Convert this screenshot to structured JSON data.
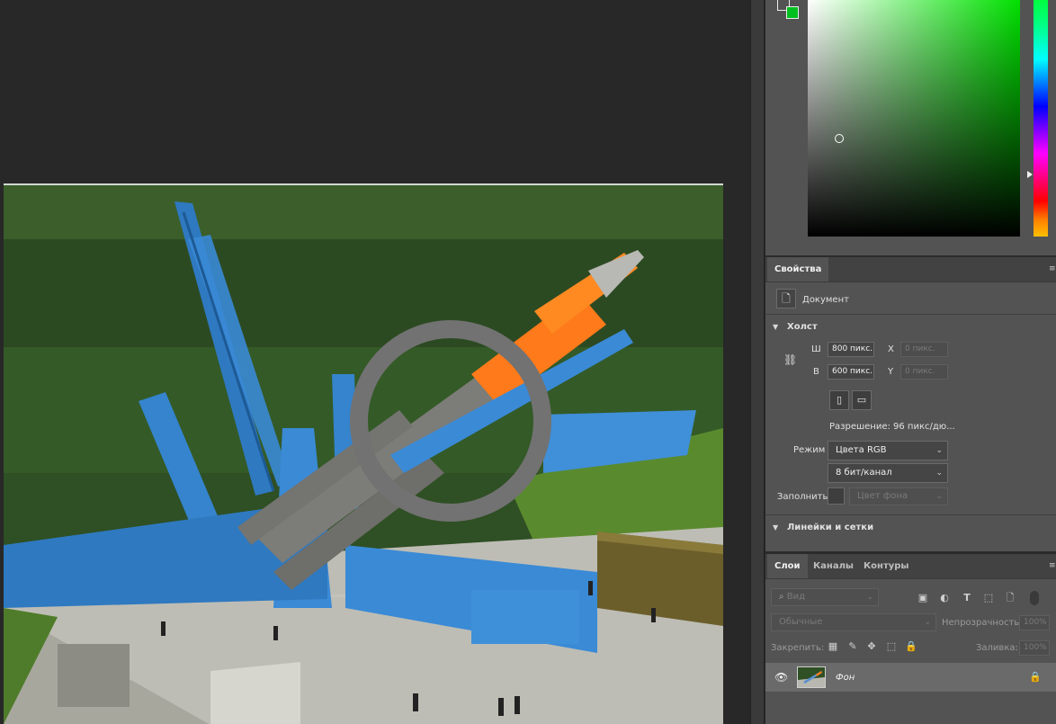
{
  "colors": {
    "foreground": "#e0e0e0",
    "background": "#00c020",
    "picker_hue": "#00e000"
  },
  "properties": {
    "tab_label": "Свойства",
    "doc_label": "Документ",
    "canvas_section": "Холст",
    "width_label": "Ш",
    "width_value": "800 пикс.",
    "height_label": "В",
    "height_value": "600 пикс.",
    "x_label": "X",
    "x_placeholder": "0 пикс.",
    "y_label": "Y",
    "y_placeholder": "0 пикс.",
    "resolution": "Разрешение: 96 пикс/дю...",
    "mode_label": "Режим",
    "mode_value": "Цвета RGB",
    "bit_depth": "8 бит/канал",
    "fill_label": "Заполнить",
    "fill_value": "Цвет фона",
    "guides_section": "Линейки и сетки"
  },
  "layers_panel": {
    "tabs": [
      "Слои",
      "Каналы",
      "Контуры"
    ],
    "search_placeholder": "Вид",
    "blend_mode": "Обычные",
    "opacity_label": "Непрозрачность:",
    "opacity_value": "100%",
    "lock_label": "Закрепить:",
    "fill_label": "Заливка:",
    "fill_value": "100%",
    "layers": [
      {
        "name": "Фон",
        "visible": true,
        "locked": true
      }
    ]
  }
}
